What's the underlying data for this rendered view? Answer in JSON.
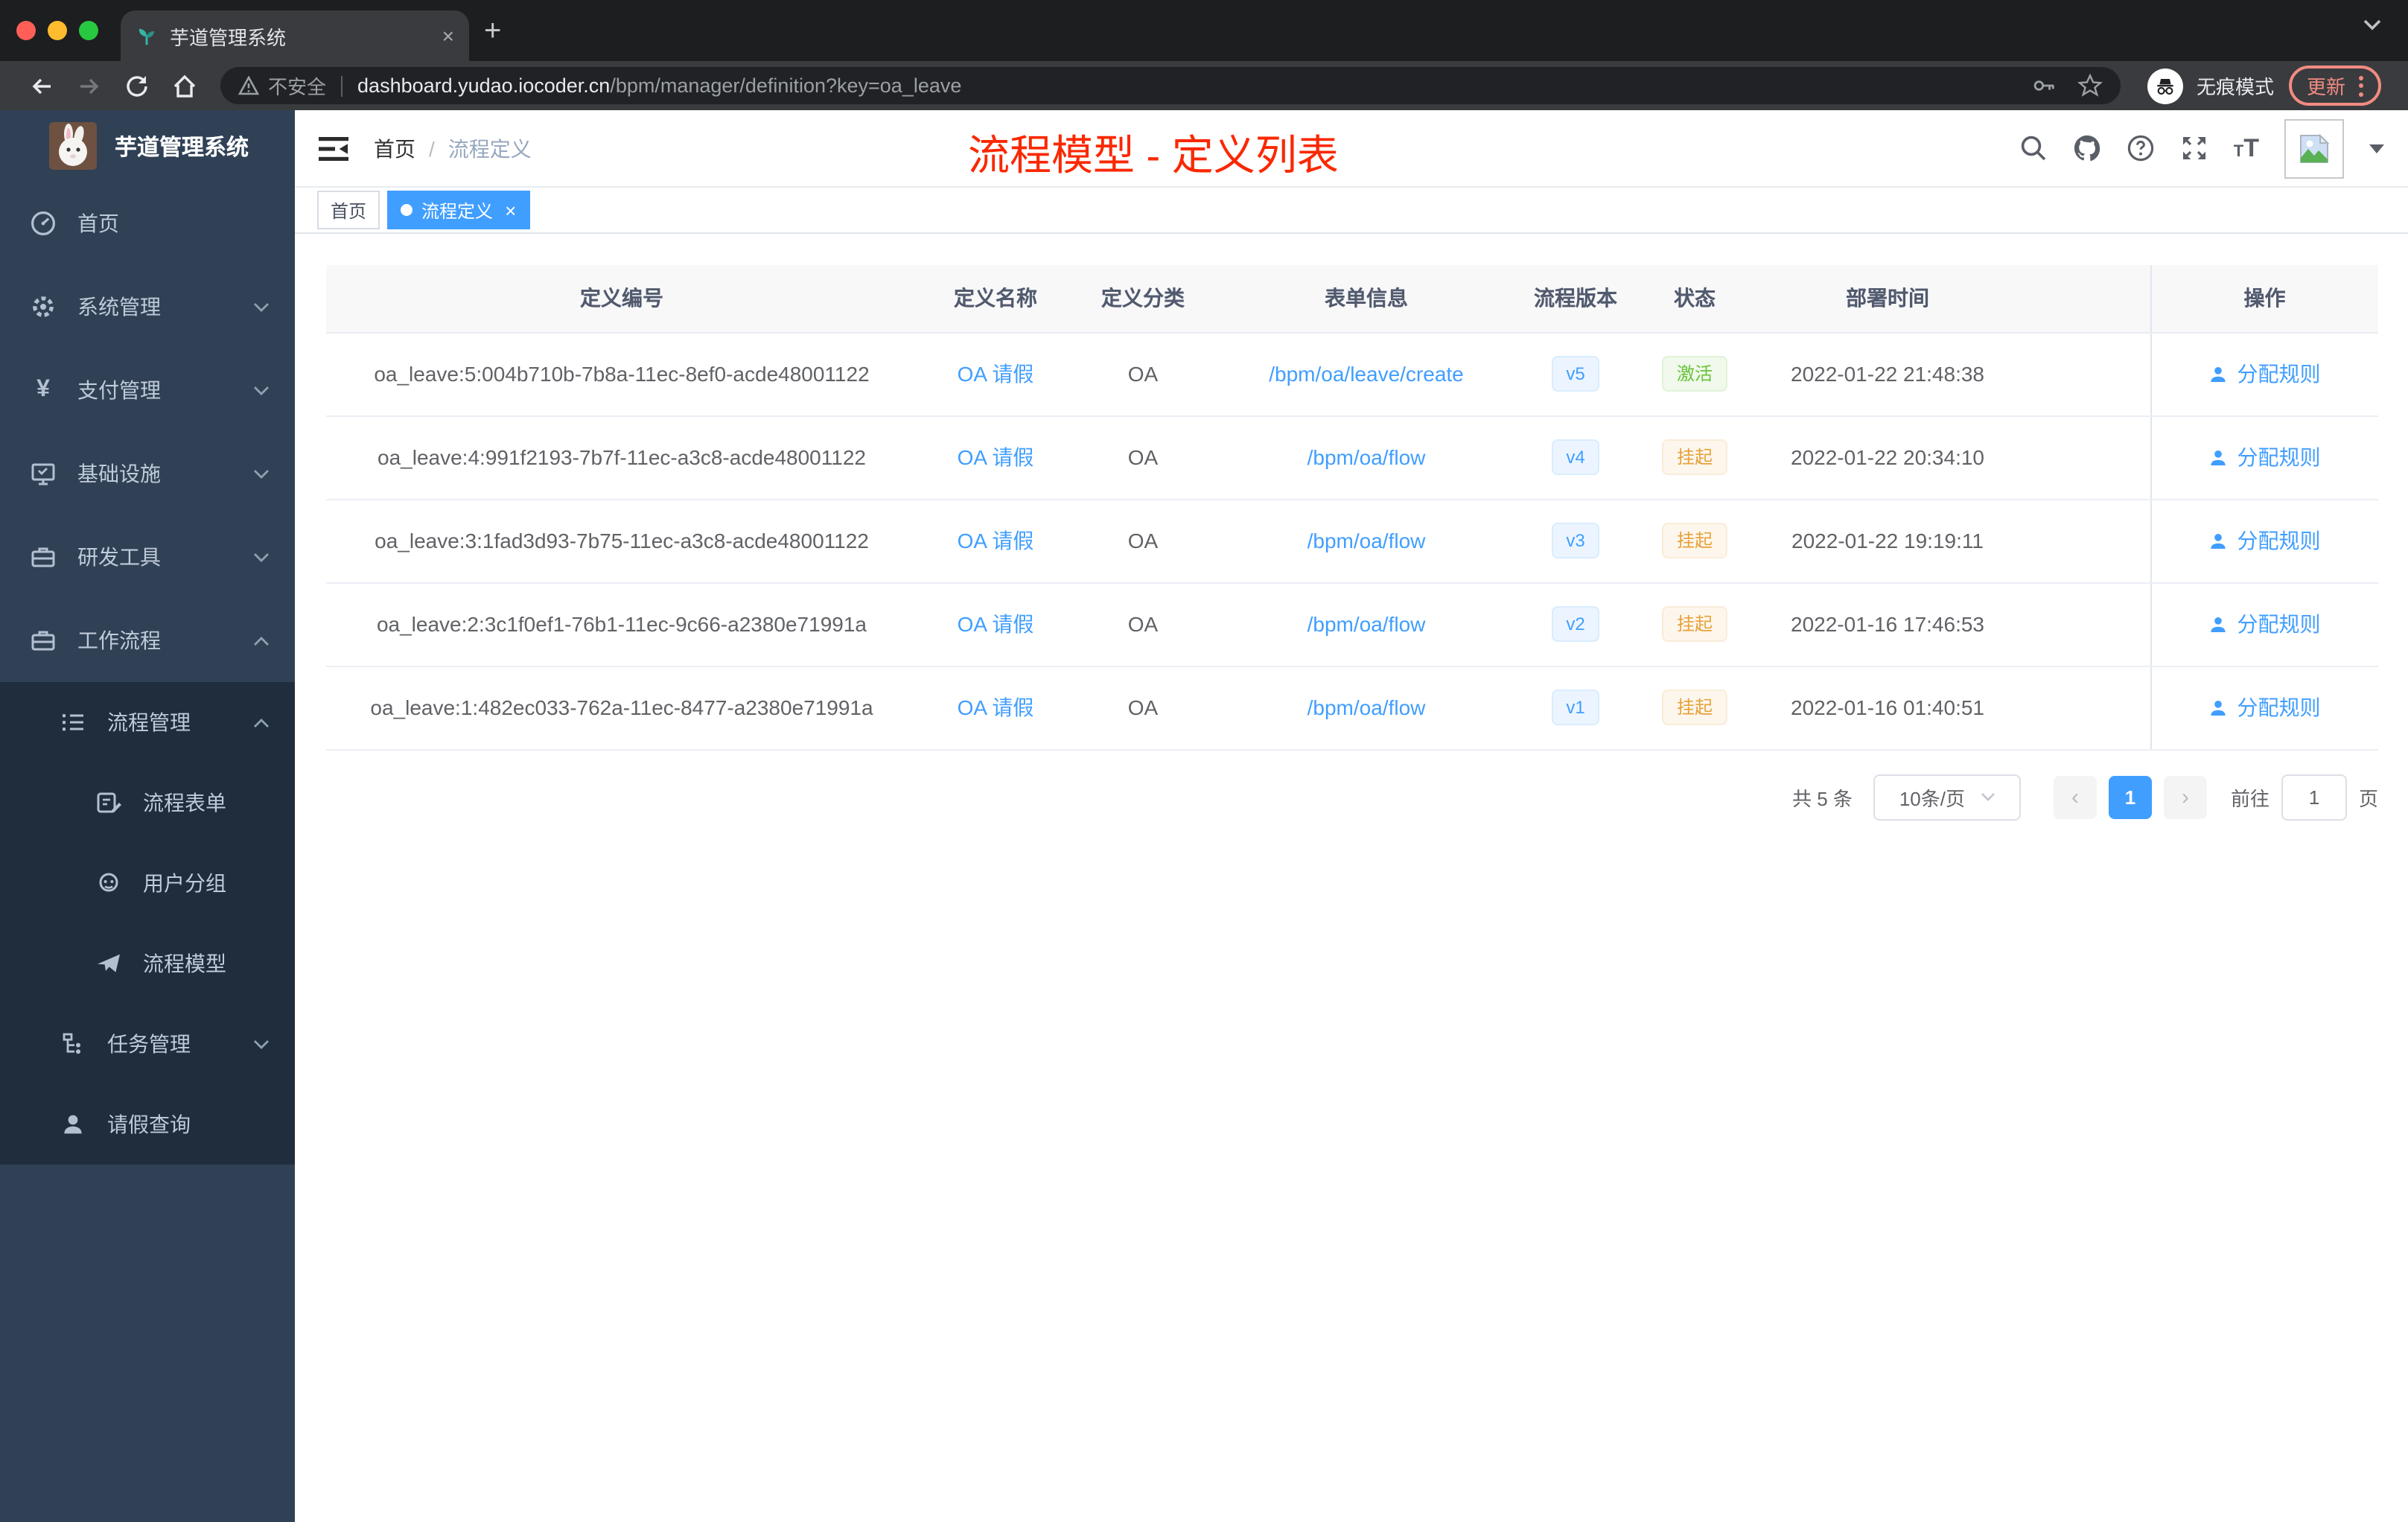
{
  "browser": {
    "tab_title": "芋道管理系统",
    "tab_close": "×",
    "new_tab_button": "+",
    "security_label": "不安全",
    "url_host": "dashboard.yudao.iocoder.cn",
    "url_path": "/bpm/manager/definition?key=oa_leave",
    "incognito_label": "无痕模式",
    "update_button": "更新"
  },
  "sidebar": {
    "app_title": "芋道管理系统",
    "items": [
      {
        "label": "首页"
      },
      {
        "label": "系统管理"
      },
      {
        "label": "支付管理"
      },
      {
        "label": "基础设施"
      },
      {
        "label": "研发工具"
      },
      {
        "label": "工作流程"
      },
      {
        "label": "流程管理"
      },
      {
        "label": "流程表单"
      },
      {
        "label": "用户分组"
      },
      {
        "label": "流程模型"
      },
      {
        "label": "任务管理"
      },
      {
        "label": "请假查询"
      }
    ]
  },
  "header": {
    "breadcrumb_home": "首页",
    "breadcrumb_sep": "/",
    "breadcrumb_current": "流程定义",
    "annotation": "流程模型 - 定义列表"
  },
  "tags": {
    "home": "首页",
    "active": "流程定义",
    "close": "×"
  },
  "table": {
    "columns": [
      "定义编号",
      "定义名称",
      "定义分类",
      "表单信息",
      "流程版本",
      "状态",
      "部署时间",
      "操作"
    ],
    "rows": [
      {
        "id": "oa_leave:5:004b710b-7b8a-11ec-8ef0-acde48001122",
        "name": "OA 请假",
        "category": "OA",
        "form": "/bpm/oa/leave/create",
        "version": "v5",
        "status": "激活",
        "deploy_time": "2022-01-22 21:48:38",
        "action": "分配规则"
      },
      {
        "id": "oa_leave:4:991f2193-7b7f-11ec-a3c8-acde48001122",
        "name": "OA 请假",
        "category": "OA",
        "form": "/bpm/oa/flow",
        "version": "v4",
        "status": "挂起",
        "deploy_time": "2022-01-22 20:34:10",
        "action": "分配规则"
      },
      {
        "id": "oa_leave:3:1fad3d93-7b75-11ec-a3c8-acde48001122",
        "name": "OA 请假",
        "category": "OA",
        "form": "/bpm/oa/flow",
        "version": "v3",
        "status": "挂起",
        "deploy_time": "2022-01-22 19:19:11",
        "action": "分配规则"
      },
      {
        "id": "oa_leave:2:3c1f0ef1-76b1-11ec-9c66-a2380e71991a",
        "name": "OA 请假",
        "category": "OA",
        "form": "/bpm/oa/flow",
        "version": "v2",
        "status": "挂起",
        "deploy_time": "2022-01-16 17:46:53",
        "action": "分配规则"
      },
      {
        "id": "oa_leave:1:482ec033-762a-11ec-8477-a2380e71991a",
        "name": "OA 请假",
        "category": "OA",
        "form": "/bpm/oa/flow",
        "version": "v1",
        "status": "挂起",
        "deploy_time": "2022-01-16 01:40:51",
        "action": "分配规则"
      }
    ]
  },
  "pagination": {
    "total": "共 5 条",
    "page_size": "10条/页",
    "prev": "‹",
    "page": "1",
    "next": "›",
    "goto_label": "前往",
    "input_value": "1",
    "unit": "页"
  },
  "colors": {
    "accent": "#409eff",
    "annotation_red": "#fa2800",
    "status_active_green": "#67c23a",
    "status_suspend_orange": "#e6a23c",
    "sidebar_bg": "#304156",
    "submenu_bg": "#1f2d3d"
  }
}
